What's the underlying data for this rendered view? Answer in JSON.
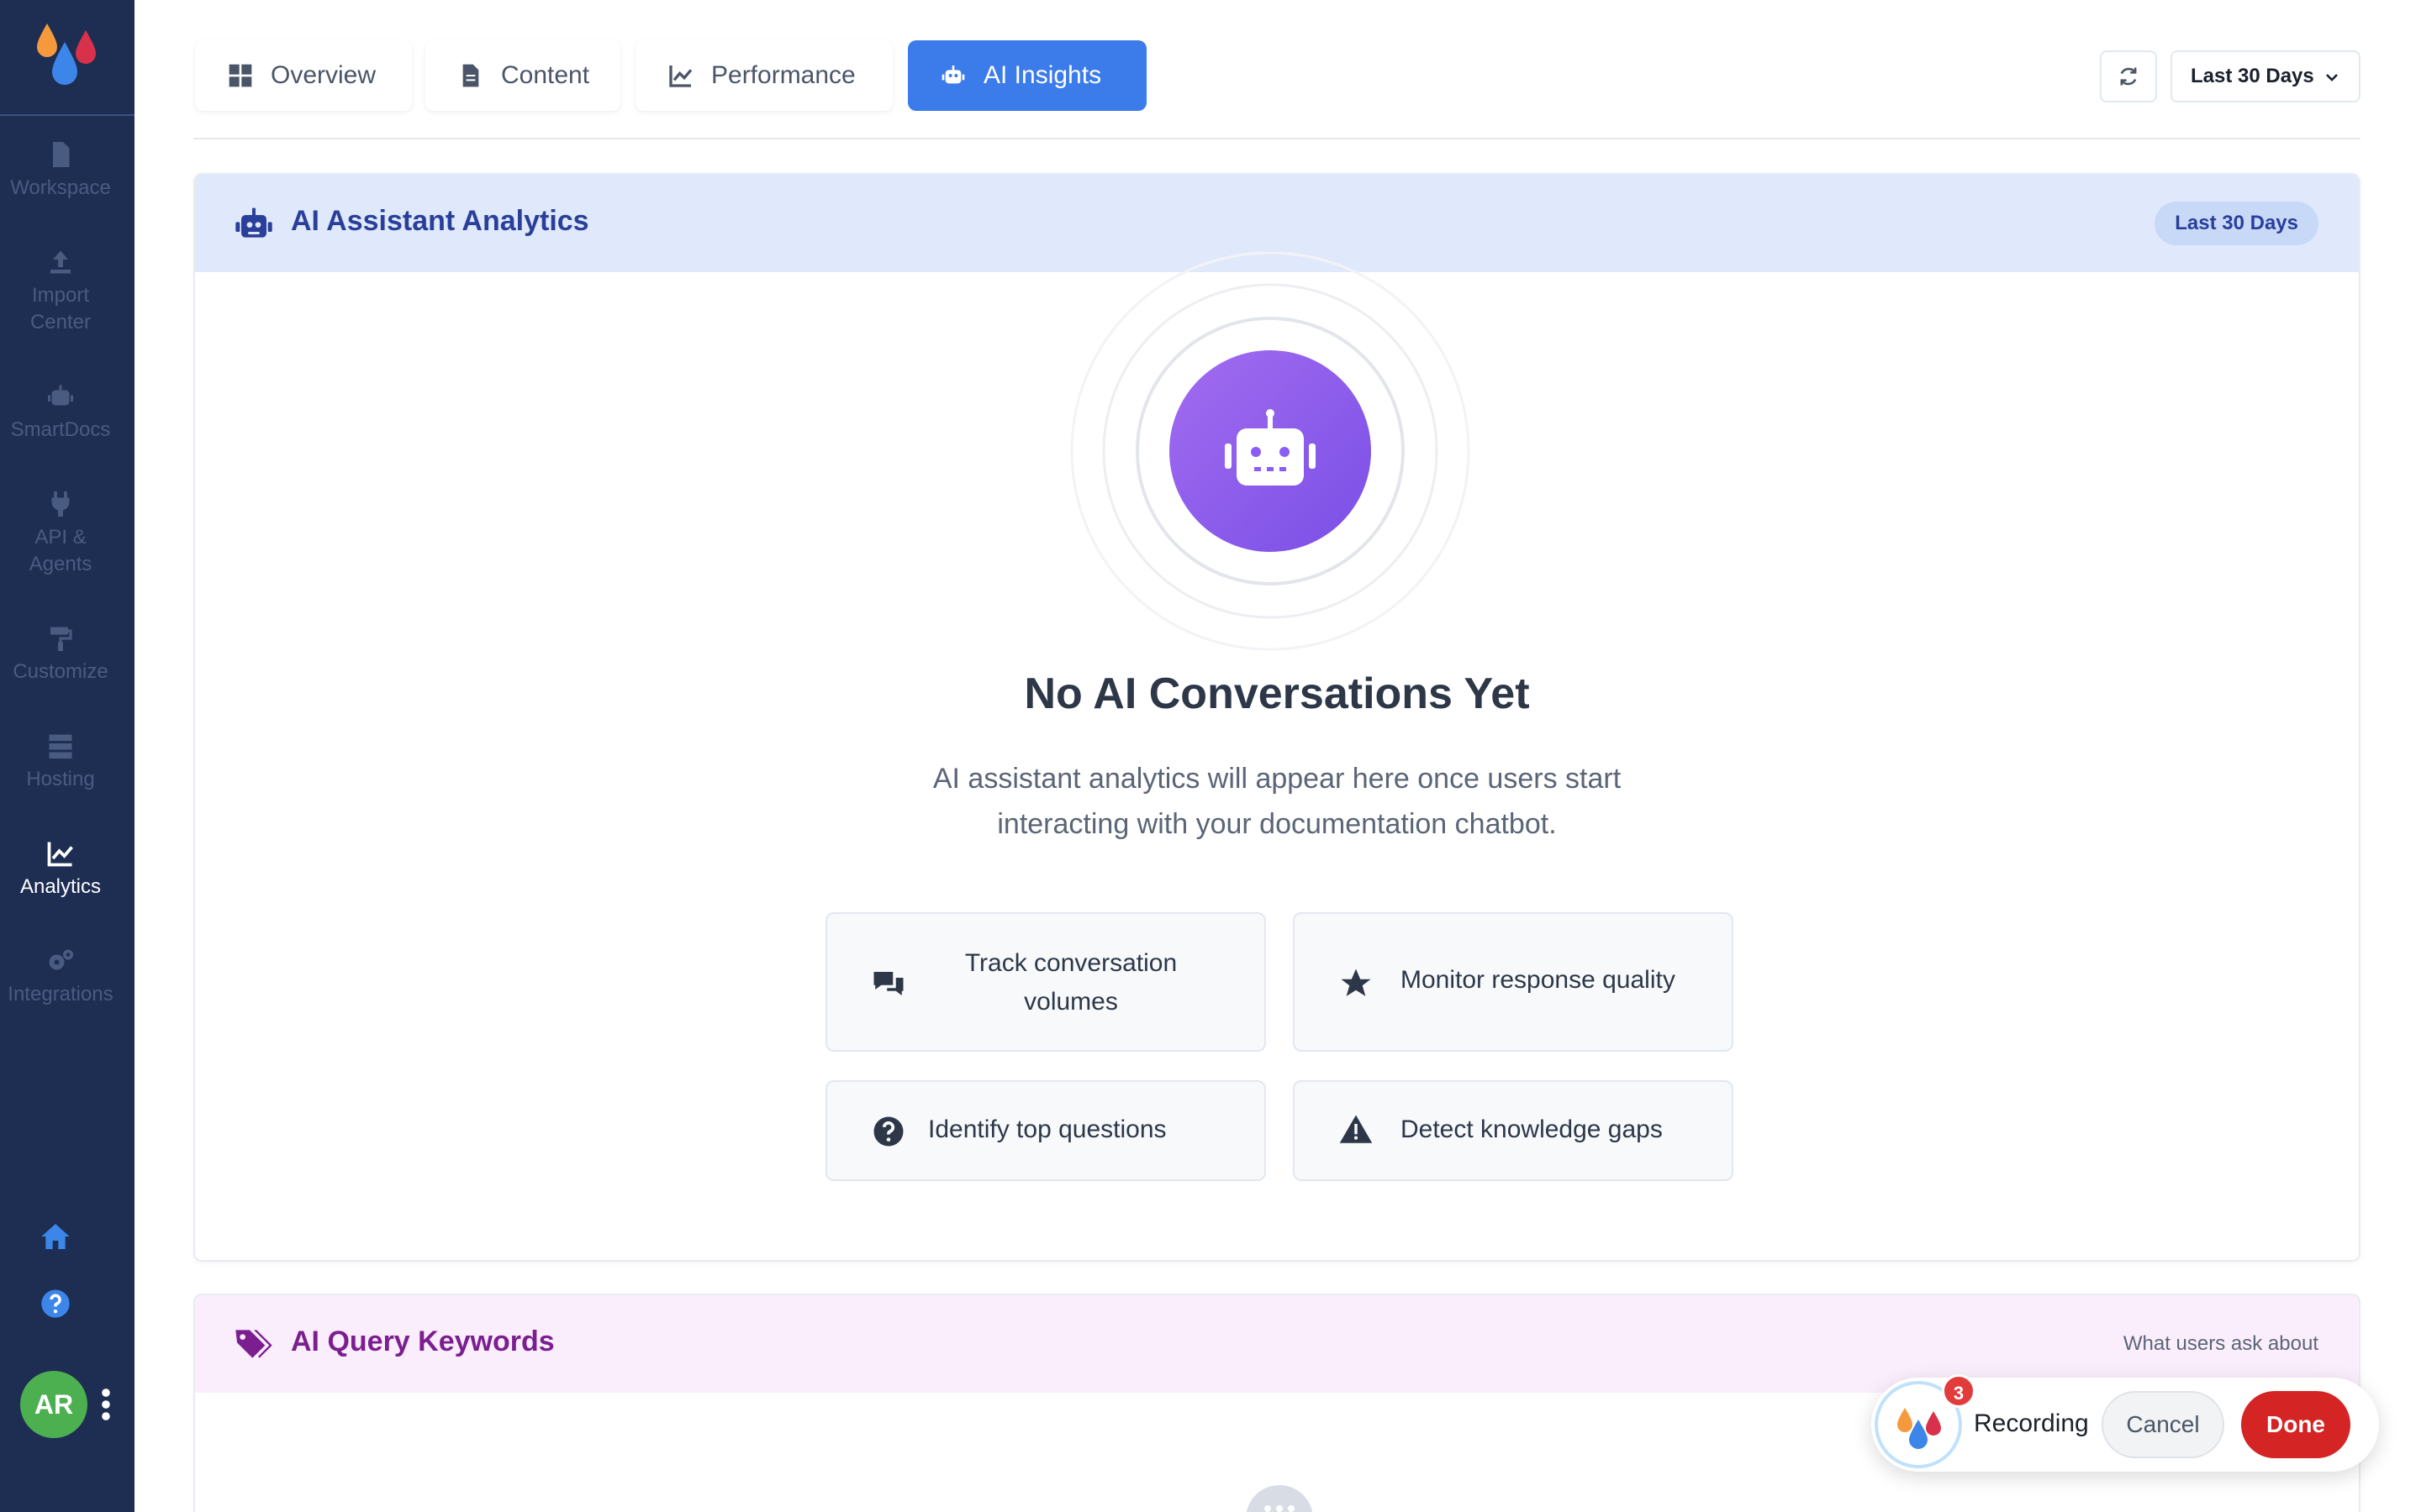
{
  "sidebar": {
    "items": [
      {
        "label": "Workspace",
        "icon": "file-icon"
      },
      {
        "label": "Import Center",
        "icon": "upload-icon"
      },
      {
        "label": "SmartDocs",
        "icon": "robot-icon"
      },
      {
        "label": "API & Agents",
        "icon": "plug-icon"
      },
      {
        "label": "Customize",
        "icon": "paint-roller-icon"
      },
      {
        "label": "Hosting",
        "icon": "server-icon"
      },
      {
        "label": "Analytics",
        "icon": "chart-line-icon",
        "active": true
      },
      {
        "label": "Integrations",
        "icon": "cogs-icon"
      }
    ],
    "avatar_initials": "AR"
  },
  "tabs": [
    {
      "label": "Overview",
      "icon": "grid-icon"
    },
    {
      "label": "Content",
      "icon": "document-icon"
    },
    {
      "label": "Performance",
      "icon": "chart-line-icon"
    },
    {
      "label": "AI Insights",
      "icon": "robot-icon",
      "active": true
    }
  ],
  "date_range": {
    "selected": "Last 30 Days"
  },
  "ai_panel": {
    "title": "AI Assistant Analytics",
    "badge": "Last 30 Days",
    "empty_title": "No AI Conversations Yet",
    "empty_desc_line1": "AI assistant analytics will appear here once users start",
    "empty_desc_line2": "interacting with your documentation chatbot.",
    "features": [
      {
        "line1": "Track conversation",
        "line2": "volumes",
        "icon": "comments-icon"
      },
      {
        "line1": "Monitor response quality",
        "line2": "",
        "icon": "star-icon"
      },
      {
        "line1": "Identify top questions",
        "line2": "",
        "icon": "question-circle-icon"
      },
      {
        "line1": "Detect knowledge gaps",
        "line2": "",
        "icon": "warning-icon"
      }
    ]
  },
  "keywords_panel": {
    "title": "AI Query Keywords",
    "subtitle": "What users ask about"
  },
  "recording": {
    "badge_count": "3",
    "label": "Recording",
    "cancel_label": "Cancel",
    "done_label": "Done"
  },
  "colors": {
    "sidebar_bg": "#1e2d52",
    "accent": "#3b7bea",
    "robot_gradient": "#8b5cf6",
    "done_red": "#d42424"
  }
}
